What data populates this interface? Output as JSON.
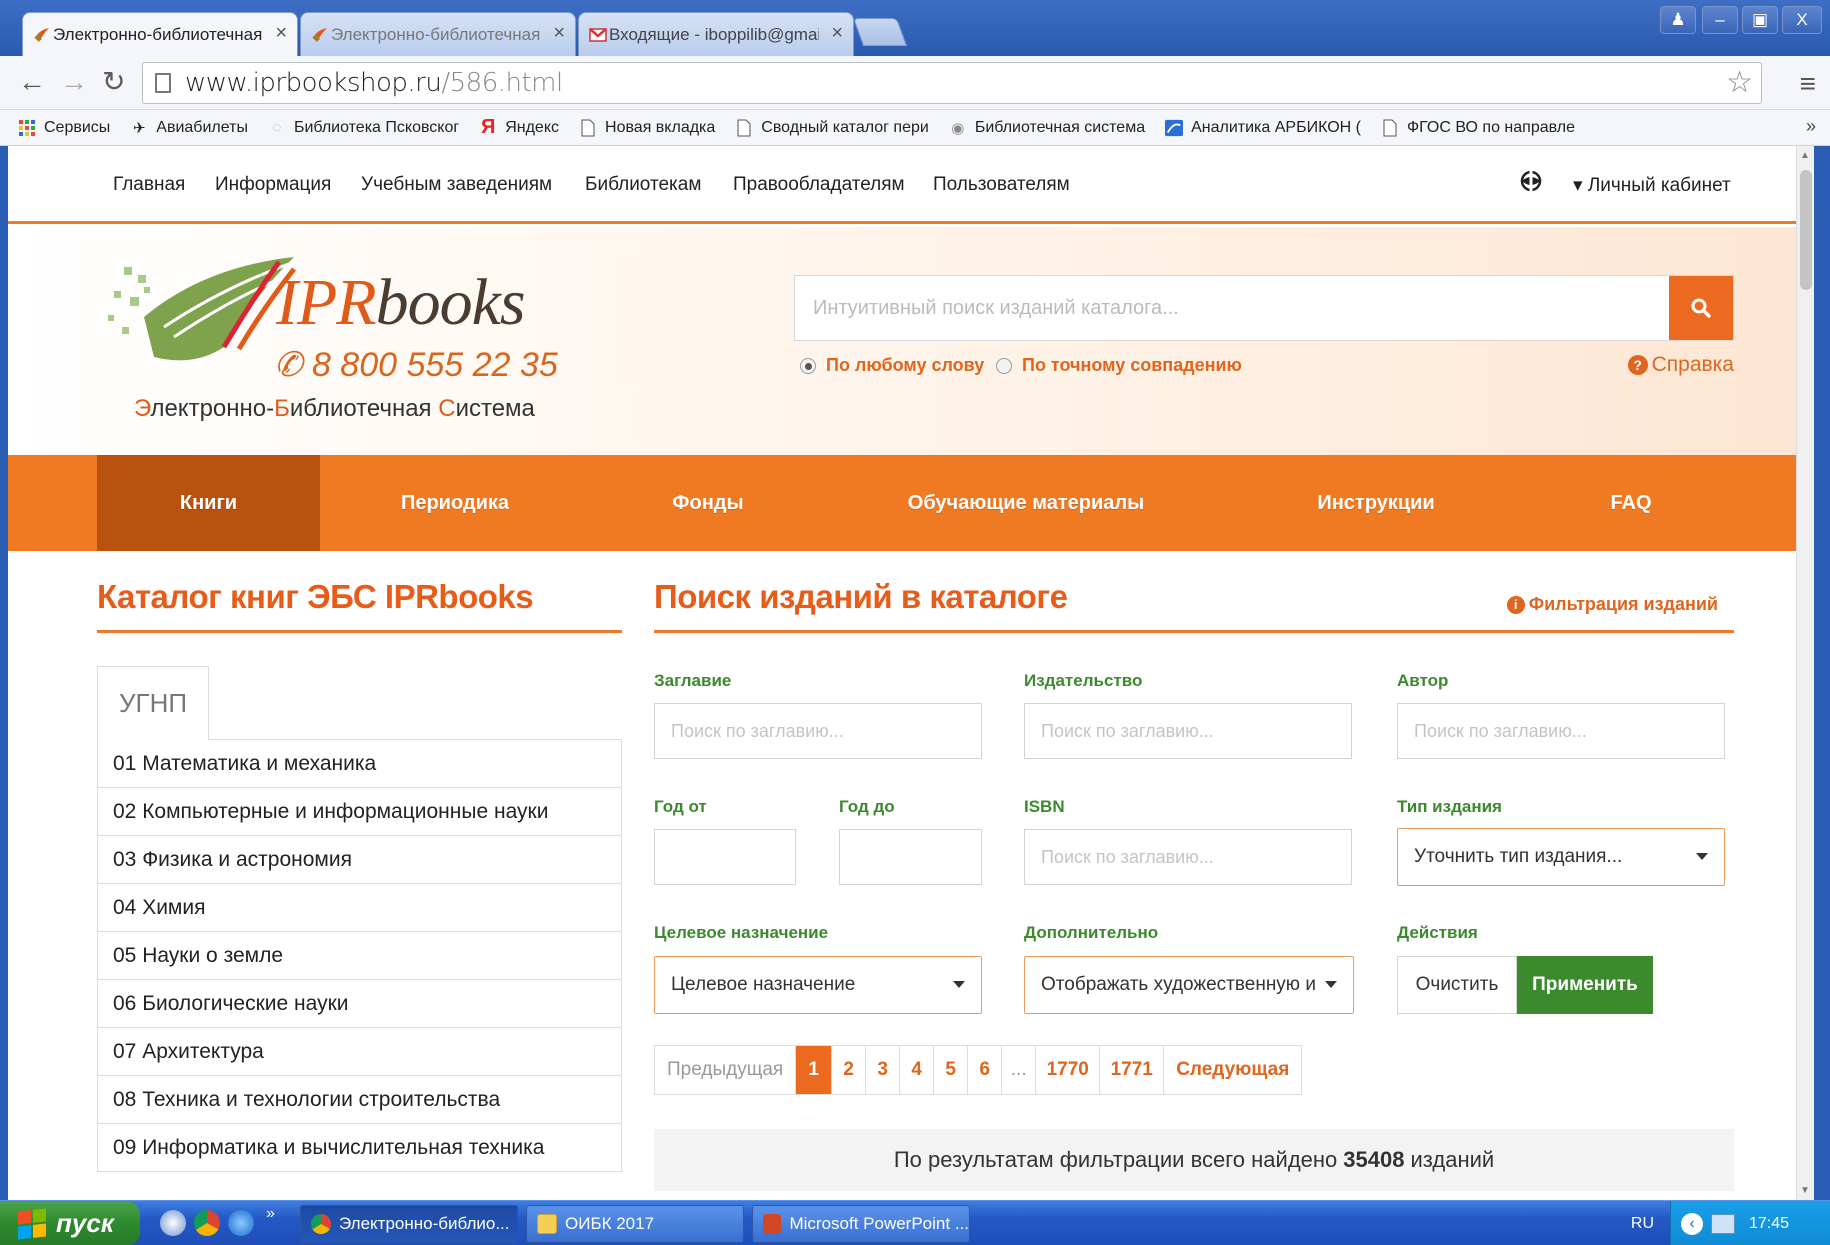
{
  "browser": {
    "tabs": [
      {
        "title": "Электронно-библиотечная",
        "active": true
      },
      {
        "title": "Электронно-библиотечная",
        "active": false
      },
      {
        "title": "Входящие - iboppilib@gmail.",
        "active": false
      }
    ],
    "close_glyph": "×",
    "window_buttons": {
      "user": "♟",
      "minimize": "–",
      "restore": "▣",
      "close": "X"
    },
    "url_host": "www.iprbookshop.ru",
    "url_path": "/586.html",
    "bookmarks": [
      {
        "label": "Сервисы",
        "icon": "apps-grid-icon"
      },
      {
        "label": "Авиабилеты",
        "icon": "plane-icon"
      },
      {
        "label": "Библиотека Псковског",
        "icon": "globe-icon"
      },
      {
        "label": "Яндекс",
        "icon": "yandex-icon"
      },
      {
        "label": "Новая вкладка",
        "icon": "page-icon"
      },
      {
        "label": "Сводный каталог пери",
        "icon": "page-icon"
      },
      {
        "label": "Библиотечная система",
        "icon": "globe-icon"
      },
      {
        "label": "Аналитика АРБИКОН (",
        "icon": "arbicon-icon"
      },
      {
        "label": "ФГОС ВО по направле",
        "icon": "page-icon"
      }
    ],
    "bookmarks_more": "»"
  },
  "topnav": {
    "items": [
      "Главная",
      "Информация",
      "Учебным заведениям",
      "Библиотекам",
      "Правообладателям",
      "Пользователям"
    ],
    "account_label": "▾ Личный кабинет"
  },
  "logo": {
    "brand_part1": "IPR",
    "brand_part2": "books",
    "phone": "8 800 555 22 35",
    "tagline_parts": [
      "Э",
      "лектронно-",
      "Б",
      "иблиотечная ",
      "С",
      "истема"
    ]
  },
  "search": {
    "placeholder": "Интуитивный поиск изданий каталога...",
    "mode_any": "По любому слову",
    "mode_exact": "По точному совпадению",
    "help": "Справка"
  },
  "mainnav": {
    "items": [
      "Книги",
      "Периодика",
      "Фонды",
      "Обучающие материалы",
      "Инструкции",
      "FAQ"
    ],
    "active_index": 0
  },
  "catalog": {
    "title": "Каталог книг ЭБС IPRbooks",
    "tab_label": "УГНП",
    "items": [
      "01 Математика и механика",
      "02 Компьютерные и информационные науки",
      "03 Физика и астрономия",
      "04 Химия",
      "05 Науки о земле",
      "06 Биологические науки",
      "07 Архитектура",
      "08 Техника и технологии строительства",
      "09 Информатика и вычислительная техника"
    ]
  },
  "filter": {
    "title": "Поиск изданий в каталоге",
    "filter_link": "Фильтрация изданий",
    "labels": {
      "title": "Заглавие",
      "publisher": "Издательство",
      "author": "Автор",
      "year_from": "Год от",
      "year_to": "Год до",
      "isbn": "ISBN",
      "type": "Тип издания",
      "purpose": "Целевое назначение",
      "extra": "Дополнительно",
      "actions": "Действия"
    },
    "placeholders": {
      "title": "Поиск по заглавию...",
      "publisher": "Поиск по заглавию...",
      "author": "Поиск по заглавию...",
      "isbn": "Поиск по заглавию..."
    },
    "type_select": "Уточнить тип издания...",
    "purpose_select": "Целевое назначение",
    "extra_select": "Отображать художественную и",
    "clear_button": "Очистить",
    "apply_button": "Применить"
  },
  "pagination": {
    "prev": "Предыдущая",
    "pages": [
      "1",
      "2",
      "3",
      "4",
      "5",
      "6",
      "...",
      "1770",
      "1771"
    ],
    "current": "1",
    "next": "Следующая"
  },
  "results": {
    "prefix": "По результатам фильтрации всего найдено",
    "count": "35408",
    "suffix": "изданий"
  },
  "taskbar": {
    "start": "пуск",
    "tasks": [
      {
        "label": "Электронно-библио...",
        "icon": "chrome-icon"
      },
      {
        "label": "ОИБК 2017",
        "icon": "folder-icon"
      },
      {
        "label": "Microsoft PowerPoint ...",
        "icon": "powerpoint-icon"
      }
    ],
    "quick_more": "»",
    "lang": "RU",
    "time": "17:45"
  },
  "colors": {
    "brand_orange": "#ef7a23",
    "nav_active": "#b9520f",
    "label_green": "#3c8a2e",
    "xp_blue": "#2458c4"
  }
}
